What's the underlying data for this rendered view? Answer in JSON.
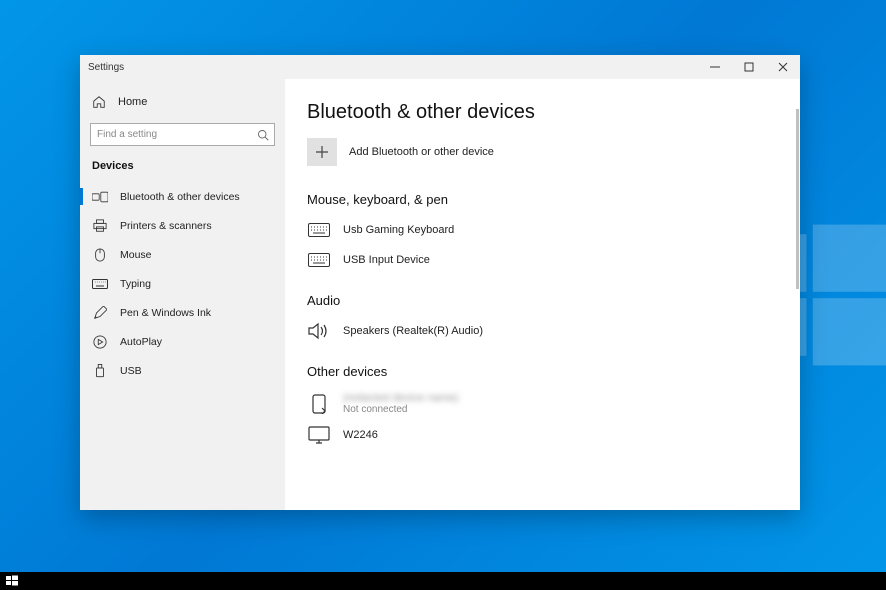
{
  "window": {
    "app_title": "Settings"
  },
  "sidebar": {
    "home_label": "Home",
    "search_placeholder": "Find a setting",
    "category_label": "Devices",
    "items": [
      {
        "label": "Bluetooth & other devices",
        "active": true,
        "icon": "bluetooth-devices-icon"
      },
      {
        "label": "Printers & scanners",
        "active": false,
        "icon": "printer-icon"
      },
      {
        "label": "Mouse",
        "active": false,
        "icon": "mouse-icon"
      },
      {
        "label": "Typing",
        "active": false,
        "icon": "keyboard-icon"
      },
      {
        "label": "Pen & Windows Ink",
        "active": false,
        "icon": "pen-icon"
      },
      {
        "label": "AutoPlay",
        "active": false,
        "icon": "autoplay-icon"
      },
      {
        "label": "USB",
        "active": false,
        "icon": "usb-icon"
      }
    ]
  },
  "content": {
    "page_title": "Bluetooth & other devices",
    "add_device_label": "Add Bluetooth or other device",
    "sections": {
      "mkp": {
        "title": "Mouse, keyboard, & pen",
        "devices": [
          {
            "name": "Usb Gaming Keyboard",
            "status": "",
            "icon": "keyboard-device-icon"
          },
          {
            "name": "USB Input Device",
            "status": "",
            "icon": "keyboard-device-icon"
          }
        ]
      },
      "audio": {
        "title": "Audio",
        "devices": [
          {
            "name": "Speakers (Realtek(R) Audio)",
            "status": "",
            "icon": "speaker-icon"
          }
        ]
      },
      "other": {
        "title": "Other devices",
        "devices": [
          {
            "name": "(redacted device name)",
            "status": "Not connected",
            "icon": "phone-icon",
            "blurred": true
          },
          {
            "name": "W2246",
            "status": "",
            "icon": "monitor-icon"
          }
        ]
      }
    }
  }
}
